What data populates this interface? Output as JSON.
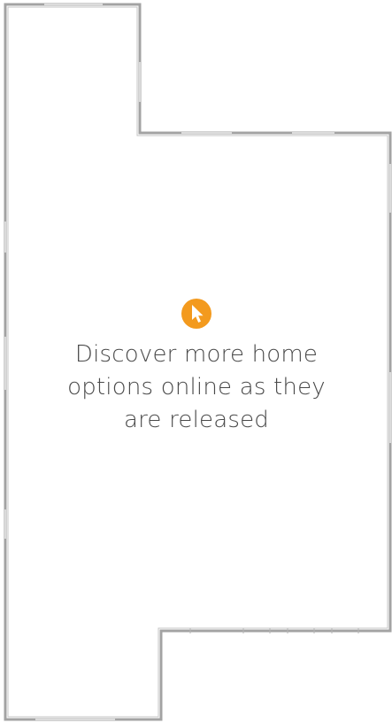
{
  "message": {
    "text": "Discover more home options online as they are released"
  },
  "colors": {
    "wall": "#a3a3a3",
    "accent": "#f39a1e",
    "text": "#4a4a4a",
    "background": "#ffffff"
  },
  "icons": {
    "message_icon": "cursor-pointer-icon"
  }
}
